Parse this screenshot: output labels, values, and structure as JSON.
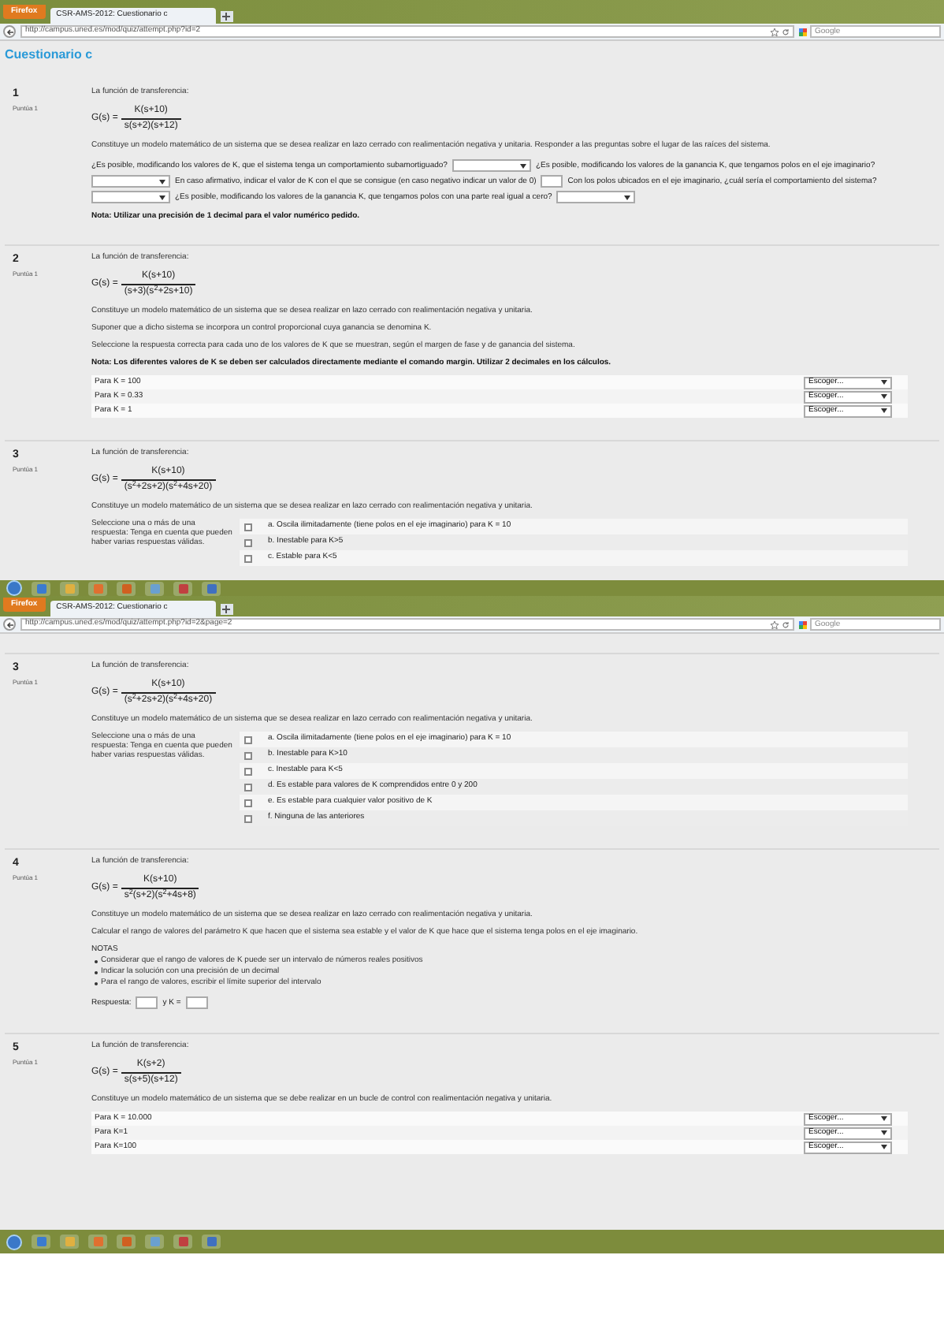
{
  "windows": [
    {
      "browser_button": "Firefox",
      "tab_title": "CSR-AMS-2012: Cuestionario c",
      "url": "http://campus.uned.es/mod/quiz/attempt.php?id=2",
      "search_placeholder": "Google",
      "heading": "Cuestionario c",
      "questions": [
        {
          "number": "1",
          "info": "Puntúa 1",
          "blocks": [
            {
              "kind": "text",
              "text": "La función de transferencia:"
            },
            {
              "kind": "formula",
              "lhs": "G(s) =",
              "numerator": "K(s+10)",
              "denominator": "s(s+2)(s+12)"
            },
            {
              "kind": "text",
              "text": "Constituye un modelo matemático de un sistema que se desea realizar en lazo cerrado con realimentación negativa y unitaria. Responder a las preguntas sobre el lugar de las raíces del sistema."
            },
            {
              "kind": "fill",
              "parts": [
                {
                  "kind": "text",
                  "text": "¿Es posible, modificando los valores de K, que el sistema tenga un comportamiento subamortiguado?"
                },
                {
                  "kind": "select"
                },
                {
                  "kind": "text",
                  "text": "¿Es posible, modificando los valores de la ganancia K, que tengamos polos en el eje imaginario?"
                },
                {
                  "kind": "select"
                },
                {
                  "kind": "text",
                  "text": "En caso afirmativo, indicar el valor de K con el que se consigue (en caso negativo indicar un valor de 0)"
                },
                {
                  "kind": "input"
                },
                {
                  "kind": "text",
                  "text": "Con los polos ubicados en el eje imaginario, ¿cuál sería el comportamiento del sistema?"
                },
                {
                  "kind": "select"
                },
                {
                  "kind": "text",
                  "text": "¿Es posible, modificando los valores de la ganancia K, que tengamos polos con una parte real igual a cero?"
                },
                {
                  "kind": "select"
                }
              ]
            },
            {
              "kind": "note",
              "text": "Nota: Utilizar una precisión de 1 decimal para el valor numérico pedido."
            }
          ]
        },
        {
          "number": "2",
          "info": "Puntúa 1",
          "blocks": [
            {
              "kind": "text",
              "text": "La función de transferencia:"
            },
            {
              "kind": "formula",
              "lhs": "G(s) =",
              "numerator": "K(s+10)",
              "denominator": "(s+3)(s$^{2}$+2s+10)"
            },
            {
              "kind": "text",
              "text": "Constituye un modelo matemático de un sistema que se desea realizar en lazo cerrado con realimentación negativa y unitaria."
            },
            {
              "kind": "text",
              "text": "Suponer que a dicho sistema se incorpora un control proporcional cuya ganancia se denomina K."
            },
            {
              "kind": "text",
              "text": "Seleccione la respuesta correcta para cada uno de los valores de K que se muestran, según el margen de fase y de ganancia del sistema."
            },
            {
              "kind": "note",
              "text": "Nota: Los diferentes valores de K se deben ser calculados directamente mediante el comando margin. Utilizar 2 decimales en los cálculos."
            },
            {
              "kind": "matches",
              "rows": [
                {
                  "label": "Para K = 100",
                  "value": "Escoger..."
                },
                {
                  "label": "Para K = 0.33",
                  "value": "Escoger..."
                },
                {
                  "label": "Para K = 1",
                  "value": "Escoger..."
                }
              ]
            }
          ]
        },
        {
          "number": "3",
          "info": "Puntúa 1",
          "blocks": [
            {
              "kind": "text",
              "text": "La función de transferencia:"
            },
            {
              "kind": "formula",
              "lhs": "G(s) =",
              "numerator": "K(s+10)",
              "denominator": "(s$^{2}$+2s+2)(s$^{2}$+4s+20)"
            },
            {
              "kind": "text",
              "text": "Constituye un modelo matemático de un sistema que se desea realizar en lazo cerrado con realimentación negativa y unitaria."
            },
            {
              "kind": "choices",
              "prompt": "Seleccione una o más de una respuesta: Tenga en cuenta que pueden haber varias respuestas válidas.",
              "options": [
                {
                  "label": "a. Oscila ilimitadamente (tiene polos en el eje imaginario) para K = 10",
                  "checked": false
                },
                {
                  "label": "b. Inestable para K>5",
                  "checked": false
                },
                {
                  "label": "c. Estable para K<5",
                  "checked": false
                }
              ]
            }
          ]
        }
      ]
    },
    {
      "browser_button": "Firefox",
      "tab_title": "CSR-AMS-2012: Cuestionario c",
      "url": "http://campus.uned.es/mod/quiz/attempt.php?id=2&page=2",
      "search_placeholder": "Google",
      "questions": [
        {
          "number": "3",
          "info": "Puntúa 1",
          "blocks": [
            {
              "kind": "text",
              "text": "La función de transferencia:"
            },
            {
              "kind": "formula",
              "lhs": "G(s) =",
              "numerator": "K(s+10)",
              "denominator": "(s$^{2}$+2s+2)(s$^{2}$+4s+20)"
            },
            {
              "kind": "text",
              "text": "Constituye un modelo matemático de un sistema que se desea realizar en lazo cerrado con realimentación negativa y unitaria."
            },
            {
              "kind": "choices",
              "prompt": "Seleccione una o más de una respuesta: Tenga en cuenta que pueden haber varias respuestas válidas.",
              "options": [
                {
                  "label": "a. Oscila ilimitadamente (tiene polos en el eje imaginario) para K = 10",
                  "checked": false
                },
                {
                  "label": "b. Inestable para K>10",
                  "checked": false
                },
                {
                  "label": "c. Inestable para K<5",
                  "checked": false
                },
                {
                  "label": "d. Es estable para valores de K comprendidos entre 0 y 200",
                  "checked": false
                },
                {
                  "label": "e. Es estable para cualquier valor positivo de K",
                  "checked": false
                },
                {
                  "label": "f. Ninguna de las anteriores",
                  "checked": false
                }
              ]
            }
          ]
        },
        {
          "number": "4",
          "info": "Puntúa 1",
          "blocks": [
            {
              "kind": "text",
              "text": "La función de transferencia:"
            },
            {
              "kind": "formula",
              "lhs": "G(s) =",
              "numerator": "K(s+10)",
              "denominator": "s$^{2}$(s+2)(s$^{2}$+4s+8)"
            },
            {
              "kind": "text",
              "text": "Constituye un modelo matemático de un sistema que se desea realizar en lazo cerrado con realimentación negativa y unitaria."
            },
            {
              "kind": "text",
              "text": "Calcular el rango de valores del parámetro K que hacen que el sistema sea estable y el valor de K que hace que el sistema tenga polos en el eje imaginario."
            },
            {
              "kind": "notes",
              "title": "NOTAS",
              "items": [
                "Considerar que el rango de valores de K puede ser un intervalo de números reales positivos",
                "Indicar la solución con una precisión de un decimal",
                "Para el rango de valores, escribir el límite superior del intervalo"
              ]
            },
            {
              "kind": "fill",
              "parts": [
                {
                  "kind": "text",
                  "text": "Respuesta:"
                },
                {
                  "kind": "input"
                },
                {
                  "kind": "text",
                  "text": "y K ="
                },
                {
                  "kind": "input"
                }
              ]
            }
          ]
        },
        {
          "number": "5",
          "info": "Puntúa 1",
          "blocks": [
            {
              "kind": "text",
              "text": "La función de transferencia:"
            },
            {
              "kind": "formula",
              "lhs": "G(s) =",
              "numerator": "K(s+2)",
              "denominator": "s(s+5)(s+12)"
            },
            {
              "kind": "text",
              "text": "Constituye un modelo matemático de un sistema que se debe realizar en un bucle de control con realimentación negativa y unitaria."
            },
            {
              "kind": "matches",
              "rows": [
                {
                  "label": "Para K = 10.000",
                  "value": "Escoger..."
                },
                {
                  "label": "Para K=1",
                  "value": "Escoger..."
                },
                {
                  "label": "Para K=100",
                  "value": "Escoger..."
                }
              ]
            }
          ]
        }
      ]
    }
  ]
}
